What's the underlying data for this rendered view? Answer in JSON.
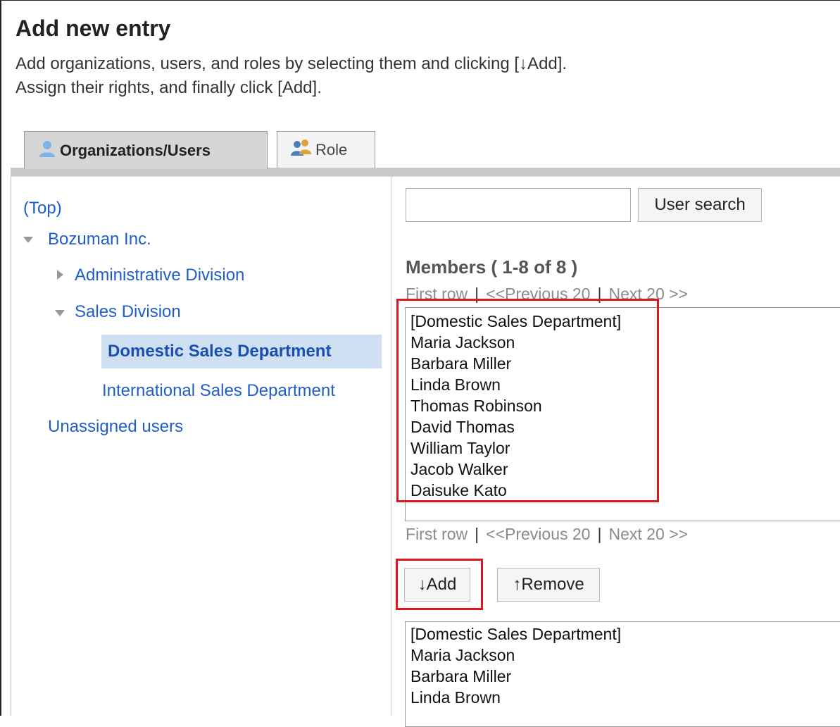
{
  "header": {
    "title": "Add new entry",
    "description_line1": "Add organizations, users, and roles by selecting them and clicking [↓Add].",
    "description_line2": "Assign their rights, and finally click [Add]."
  },
  "tabs": [
    {
      "label": "Organizations/Users",
      "icon": "user-icon",
      "active": true
    },
    {
      "label": "Role",
      "icon": "role-icon",
      "active": false
    }
  ],
  "tree": {
    "top": "(Top)",
    "company": "Bozuman Inc.",
    "admin_division": "Administrative Division",
    "sales_division": "Sales Division",
    "domestic_sales": "Domestic Sales Department",
    "international_sales": "International Sales Department",
    "unassigned": "Unassigned users"
  },
  "search": {
    "value": "",
    "button_label": "User search"
  },
  "members": {
    "title": "Members ( 1-8 of 8 )",
    "pager": {
      "first": "First row",
      "previous": "<<Previous 20",
      "next": "Next 20 >>"
    },
    "items": [
      "[Domestic Sales Department]",
      "Maria Jackson",
      "Barbara Miller",
      "Linda Brown",
      "Thomas Robinson",
      "David Thomas",
      "William Taylor",
      "Jacob Walker",
      "Daisuke Kato"
    ]
  },
  "actions": {
    "add_label": "↓Add",
    "remove_label": "↑Remove"
  },
  "selected": {
    "items": [
      "[Domestic Sales Department]",
      "Maria Jackson",
      "Barbara Miller",
      "Linda Brown"
    ]
  },
  "colors": {
    "link": "#1f5ec9",
    "highlight": "#e0161e",
    "selected_bg": "#cfe0f3"
  }
}
